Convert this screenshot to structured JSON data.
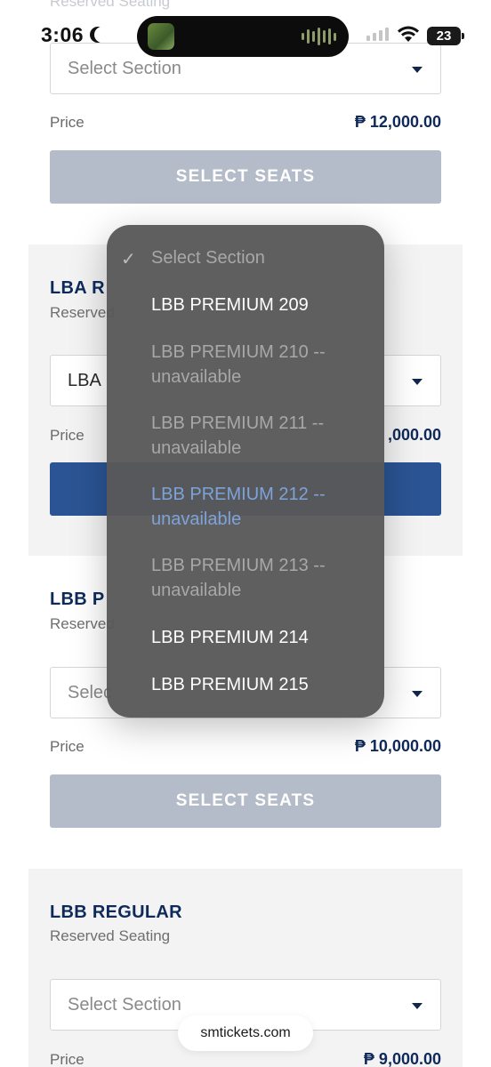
{
  "status_bar": {
    "time": "3:06",
    "battery": "23"
  },
  "ghost_label": "Reserved Seating",
  "cards": {
    "top": {
      "select_value": "Select Section",
      "price_label": "Price",
      "price_value": "₱ 12,000.00",
      "button_label": "SELECT SEATS"
    },
    "lba": {
      "title": "LBA REGULAR",
      "title_visible": "LBA R",
      "subtitle": "Reserved Seating",
      "subtitle_visible": "Reserved",
      "select_value_visible": "LBA",
      "price_label": "Price",
      "price_value_visible": ",000.00"
    },
    "lbb_premium": {
      "title_visible": "LBB P",
      "subtitle_visible": "Reserved",
      "select_value_visible": "Selec",
      "price_label": "Price",
      "price_value": "₱ 10,000.00",
      "button_label": "SELECT SEATS"
    },
    "lbb_regular": {
      "title": "LBB REGULAR",
      "subtitle": "Reserved Seating",
      "select_value": "Select Section",
      "price_label": "Price",
      "price_value": "₱ 9,000.00"
    }
  },
  "dropdown": {
    "options": [
      {
        "label": "Select Section",
        "selected": true,
        "state": "dim"
      },
      {
        "label": "LBB PREMIUM 209",
        "state": "available"
      },
      {
        "label": "LBB PREMIUM 210 -- unavailable",
        "state": "unavailable"
      },
      {
        "label": "LBB PREMIUM 211 -- unavailable",
        "state": "unavailable"
      },
      {
        "label": "LBB PREMIUM 212 -- unavailable",
        "state": "focused"
      },
      {
        "label": "LBB PREMIUM 213 -- unavailable",
        "state": "unavailable"
      },
      {
        "label": "LBB PREMIUM 214",
        "state": "available"
      },
      {
        "label": "LBB PREMIUM 215",
        "state": "available"
      }
    ]
  },
  "url_pill": "smtickets.com",
  "colors": {
    "navy": "#0f2a5a",
    "active_button": "#2b5494",
    "disabled_button": "#b4bcc9",
    "dropdown_bg": "#585858",
    "focused_option": "#7da3d9"
  }
}
